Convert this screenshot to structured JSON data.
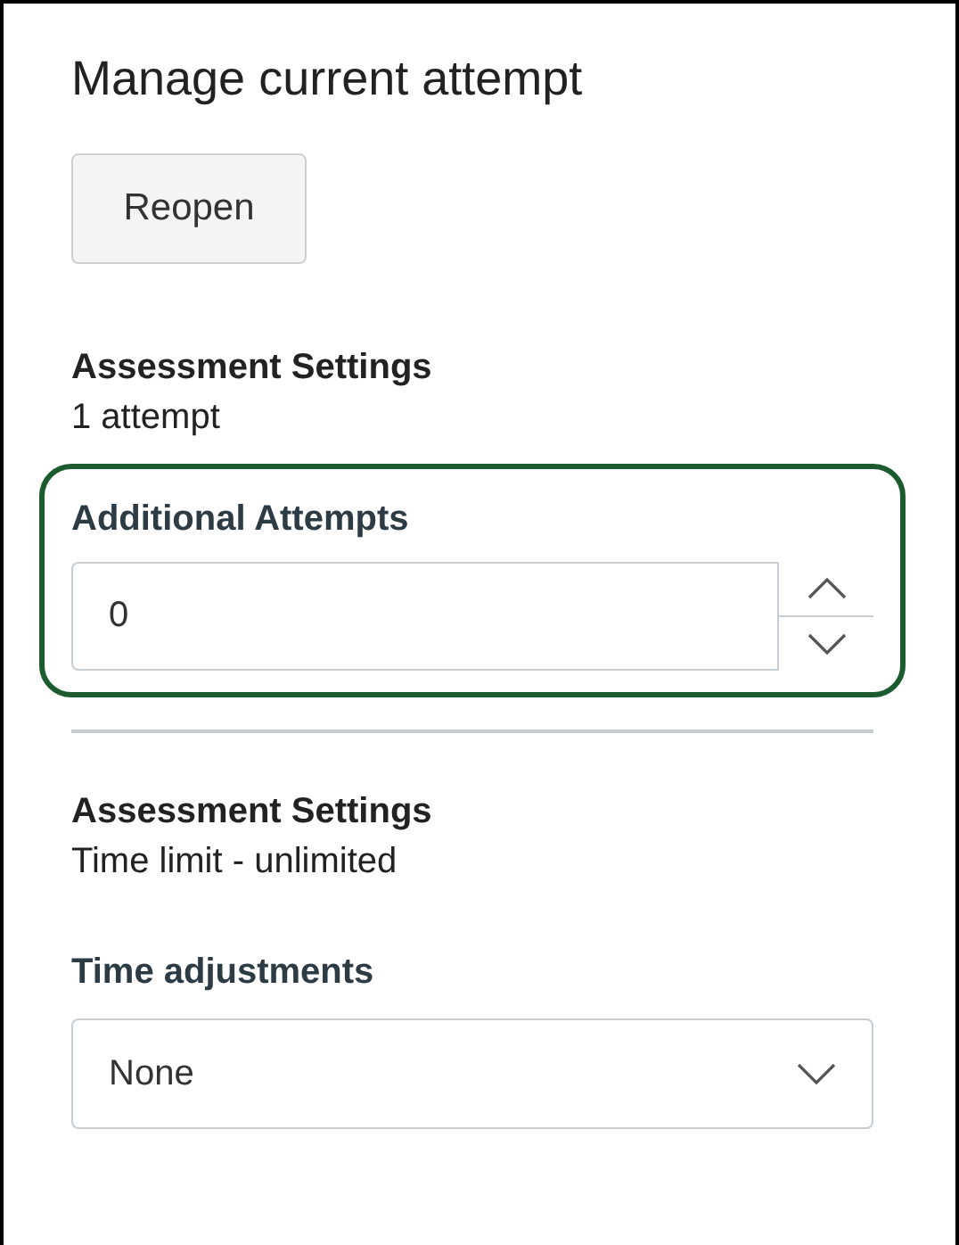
{
  "panel": {
    "title": "Manage current attempt",
    "reopen_button": "Reopen"
  },
  "attempts": {
    "heading": "Assessment Settings",
    "detail": "1 attempt",
    "field_label": "Additional Attempts",
    "value": "0",
    "highlighted": true
  },
  "time": {
    "heading": "Assessment Settings",
    "detail": "Time limit - unlimited",
    "field_label": "Time adjustments",
    "value": "None"
  }
}
